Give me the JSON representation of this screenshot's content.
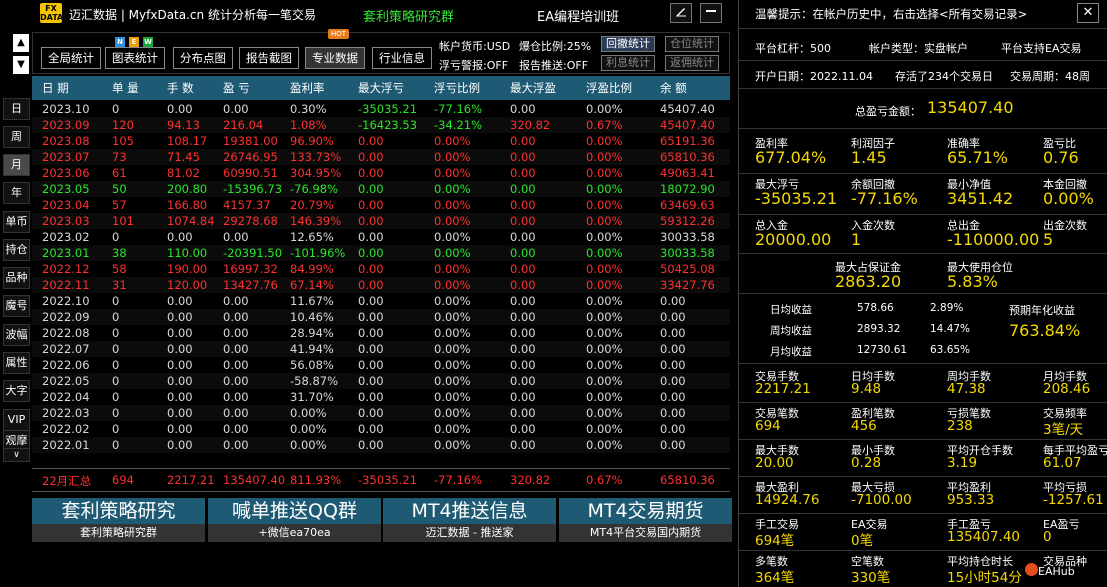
{
  "header": {
    "logo_text": "FX DATA",
    "app_title": "迈汇数据 | MyfxData.cn  统计分析每一笔交易",
    "group_title": "套利策略研究群",
    "ea_title": "EA编程培训班",
    "edit_icon": "pencil-icon",
    "minimize_icon": "minimize-icon"
  },
  "side_nav": {
    "up_arrow": "▲",
    "down_arrow": "▼",
    "items": [
      "日",
      "周",
      "月",
      "年",
      "单币",
      "持仓",
      "品种",
      "魔号",
      "波幅",
      "属性",
      "大字",
      "VIP",
      "观摩"
    ],
    "expand": "∨",
    "active_index": 2
  },
  "toolbar": {
    "tabs": [
      "全局统计",
      "图表统计",
      "分布点图",
      "报告截图",
      "专业数据",
      "行业信息"
    ],
    "active_tab": 4,
    "new_badge": [
      "N",
      "E",
      "W"
    ],
    "hot_badge": "HOT",
    "account_currency": "帐户货币:USD",
    "drawdown_ratio": "爆仓比例:25%",
    "floating_alert": "浮亏警报:OFF",
    "report_push": "报告推送:OFF",
    "buttons": [
      {
        "label": "回撤统计",
        "on": true
      },
      {
        "label": "仓位统计",
        "on": false
      },
      {
        "label": "利息统计",
        "on": false
      },
      {
        "label": "返佣统计",
        "on": false
      }
    ]
  },
  "table": {
    "headers": [
      "日 期",
      "单 量",
      "手 数",
      "盈 亏",
      "盈利率",
      "最大浮亏",
      "浮亏比例",
      "最大浮盈",
      "浮盈比例",
      "余 额"
    ],
    "rows": [
      {
        "c": "g",
        "v": [
          "2023.10",
          "0",
          "0.00",
          "0.00",
          "0.30%",
          "-35035.21",
          "-77.16%",
          "0.00",
          "0.00%",
          "45407.40"
        ]
      },
      {
        "c": "r",
        "v": [
          "2023.09",
          "120",
          "94.13",
          "216.04",
          "1.08%",
          "-16423.53",
          "-34.21%",
          "320.82",
          "0.67%",
          "45407.40"
        ]
      },
      {
        "c": "r",
        "v": [
          "2023.08",
          "105",
          "108.17",
          "19381.00",
          "96.90%",
          "0.00",
          "0.00%",
          "0.00",
          "0.00%",
          "65191.36"
        ]
      },
      {
        "c": "r",
        "v": [
          "2023.07",
          "73",
          "71.45",
          "26746.95",
          "133.73%",
          "0.00",
          "0.00%",
          "0.00",
          "0.00%",
          "65810.36"
        ]
      },
      {
        "c": "r",
        "v": [
          "2023.06",
          "61",
          "81.02",
          "60990.51",
          "304.95%",
          "0.00",
          "0.00%",
          "0.00",
          "0.00%",
          "49063.41"
        ]
      },
      {
        "c": "gr",
        "v": [
          "2023.05",
          "50",
          "200.80",
          "-15396.73",
          "-76.98%",
          "0.00",
          "0.00%",
          "0.00",
          "0.00%",
          "18072.90"
        ]
      },
      {
        "c": "r",
        "v": [
          "2023.04",
          "57",
          "166.80",
          "4157.37",
          "20.79%",
          "0.00",
          "0.00%",
          "0.00",
          "0.00%",
          "63469.63"
        ]
      },
      {
        "c": "r",
        "v": [
          "2023.03",
          "101",
          "1074.84",
          "29278.68",
          "146.39%",
          "0.00",
          "0.00%",
          "0.00",
          "0.00%",
          "59312.26"
        ]
      },
      {
        "c": "g",
        "v": [
          "2023.02",
          "0",
          "0.00",
          "0.00",
          "12.65%",
          "0.00",
          "0.00%",
          "0.00",
          "0.00%",
          "30033.58"
        ]
      },
      {
        "c": "gr",
        "v": [
          "2023.01",
          "38",
          "110.00",
          "-20391.50",
          "-101.96%",
          "0.00",
          "0.00%",
          "0.00",
          "0.00%",
          "30033.58"
        ]
      },
      {
        "c": "r",
        "v": [
          "2022.12",
          "58",
          "190.00",
          "16997.32",
          "84.99%",
          "0.00",
          "0.00%",
          "0.00",
          "0.00%",
          "50425.08"
        ]
      },
      {
        "c": "r",
        "v": [
          "2022.11",
          "31",
          "120.00",
          "13427.76",
          "67.14%",
          "0.00",
          "0.00%",
          "0.00",
          "0.00%",
          "33427.76"
        ]
      },
      {
        "c": "g",
        "v": [
          "2022.10",
          "0",
          "0.00",
          "0.00",
          "11.67%",
          "0.00",
          "0.00%",
          "0.00",
          "0.00%",
          "0.00"
        ]
      },
      {
        "c": "g",
        "v": [
          "2022.09",
          "0",
          "0.00",
          "0.00",
          "10.46%",
          "0.00",
          "0.00%",
          "0.00",
          "0.00%",
          "0.00"
        ]
      },
      {
        "c": "g",
        "v": [
          "2022.08",
          "0",
          "0.00",
          "0.00",
          "28.94%",
          "0.00",
          "0.00%",
          "0.00",
          "0.00%",
          "0.00"
        ]
      },
      {
        "c": "g",
        "v": [
          "2022.07",
          "0",
          "0.00",
          "0.00",
          "41.94%",
          "0.00",
          "0.00%",
          "0.00",
          "0.00%",
          "0.00"
        ]
      },
      {
        "c": "g",
        "v": [
          "2022.06",
          "0",
          "0.00",
          "0.00",
          "56.08%",
          "0.00",
          "0.00%",
          "0.00",
          "0.00%",
          "0.00"
        ]
      },
      {
        "c": "g",
        "v": [
          "2022.05",
          "0",
          "0.00",
          "0.00",
          "-58.87%",
          "0.00",
          "0.00%",
          "0.00",
          "0.00%",
          "0.00"
        ]
      },
      {
        "c": "g",
        "v": [
          "2022.04",
          "0",
          "0.00",
          "0.00",
          "31.70%",
          "0.00",
          "0.00%",
          "0.00",
          "0.00%",
          "0.00"
        ]
      },
      {
        "c": "g",
        "v": [
          "2022.03",
          "0",
          "0.00",
          "0.00",
          "0.00%",
          "0.00",
          "0.00%",
          "0.00",
          "0.00%",
          "0.00"
        ]
      },
      {
        "c": "g",
        "v": [
          "2022.02",
          "0",
          "0.00",
          "0.00",
          "0.00%",
          "0.00",
          "0.00%",
          "0.00",
          "0.00%",
          "0.00"
        ]
      },
      {
        "c": "g",
        "v": [
          "2022.01",
          "0",
          "0.00",
          "0.00",
          "0.00%",
          "0.00",
          "0.00%",
          "0.00",
          "0.00%",
          "0.00"
        ]
      }
    ],
    "summary": [
      "22月汇总",
      "694",
      "2217.21",
      "135407.40",
      "811.93%",
      "-35035.21",
      "-77.16%",
      "320.82",
      "0.67%",
      "65810.36"
    ]
  },
  "promos": [
    {
      "title": "套利策略研究",
      "sub": "套利策略研究群"
    },
    {
      "title": "喊单推送QQ群",
      "sub": "+微信ea70ea"
    },
    {
      "title": "MT4推送信息",
      "sub": "迈汇数据 - 推送家"
    },
    {
      "title": "MT4交易期货",
      "sub": "MT4平台交易国内期货"
    }
  ],
  "right_panel": {
    "tip": "温馨提示：在帐户历史中，右击选择<所有交易记录>",
    "close_icon": "close-icon",
    "leverage": "平台杠杆：500",
    "account_type": "帐户类型：实盘帐户",
    "ea_support": "平台支持EA交易",
    "open_date": "开户日期：2022.11.04",
    "trade_days": "存活了234个交易日",
    "trade_cycle": "交易周期：48周",
    "total_label": "总盈亏金额：",
    "total_value": "135407.40",
    "grid1": [
      {
        "label": "盈利率",
        "value": "677.04%"
      },
      {
        "label": "利润因子",
        "value": "1.45"
      },
      {
        "label": "准确率",
        "value": "65.71%"
      },
      {
        "label": "盈亏比",
        "value": "0.76"
      },
      {
        "label": "最大浮亏",
        "value": "-35035.21"
      },
      {
        "label": "余额回撤",
        "value": "-77.16%"
      },
      {
        "label": "最小净值",
        "value": "3451.42"
      },
      {
        "label": "本金回撤",
        "value": "0.00%"
      },
      {
        "label": "总入金",
        "value": "20000.00"
      },
      {
        "label": "入金次数",
        "value": "1"
      },
      {
        "label": "总出金",
        "value": "-110000.00"
      },
      {
        "label": "出金次数",
        "value": "5"
      }
    ],
    "margin": [
      {
        "label": "最大占保证金",
        "value": "2863.20"
      },
      {
        "label": "最大使用仓位",
        "value": "5.83%"
      }
    ],
    "daily": [
      {
        "label": "日均收益",
        "amount": "578.66",
        "pct": "2.89%"
      },
      {
        "label": "周均收益",
        "amount": "2893.32",
        "pct": "14.47%"
      },
      {
        "label": "月均收益",
        "amount": "12730.61",
        "pct": "63.65%"
      }
    ],
    "annual_label": "预期年化收益",
    "annual_value": "763.84%",
    "grid2": [
      {
        "label": "交易手数",
        "value": "2217.21"
      },
      {
        "label": "日均手数",
        "value": "9.48"
      },
      {
        "label": "周均手数",
        "value": "47.38"
      },
      {
        "label": "月均手数",
        "value": "208.46"
      },
      {
        "label": "交易笔数",
        "value": "694"
      },
      {
        "label": "盈利笔数",
        "value": "456"
      },
      {
        "label": "亏损笔数",
        "value": "238"
      },
      {
        "label": "交易频率",
        "value": "3笔/天"
      },
      {
        "label": "最大手数",
        "value": "20.00"
      },
      {
        "label": "最小手数",
        "value": "0.28"
      },
      {
        "label": "平均开仓手数",
        "value": "3.19"
      },
      {
        "label": "每手平均盈亏",
        "value": "61.07"
      },
      {
        "label": "最大盈利",
        "value": "14924.76"
      },
      {
        "label": "最大亏损",
        "value": "-7100.00"
      },
      {
        "label": "平均盈利",
        "value": "953.33"
      },
      {
        "label": "平均亏损",
        "value": "-1257.61"
      },
      {
        "label": "手工交易",
        "value": "694笔"
      },
      {
        "label": "EA交易",
        "value": "0笔"
      },
      {
        "label": "手工盈亏",
        "value": "135407.40"
      },
      {
        "label": "EA盈亏",
        "value": "0"
      },
      {
        "label": "多笔数",
        "value": "364笔"
      },
      {
        "label": "空笔数",
        "value": "330笔"
      },
      {
        "label": "平均持仓时长",
        "value": "15小时54分"
      },
      {
        "label": "交易品种",
        "value": ""
      }
    ],
    "watermark": "EAHub"
  }
}
